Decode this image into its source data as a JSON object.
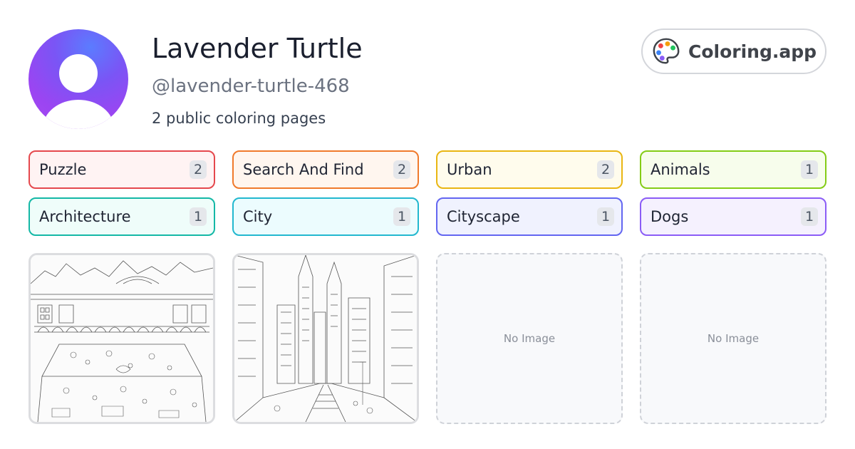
{
  "profile": {
    "name": "Lavender Turtle",
    "handle": "@lavender-turtle-468",
    "page_count_text": "2 public coloring pages",
    "avatar_icon": "user-avatar-icon",
    "avatar_gradient": [
      "#5b7cff",
      "#a848ef"
    ]
  },
  "brand": {
    "label": "Coloring.app",
    "icon": "palette-icon"
  },
  "tags": [
    {
      "label": "Puzzle",
      "count": "2",
      "border": "#e5484d",
      "bg": "#fff3f3"
    },
    {
      "label": "Search And Find",
      "count": "2",
      "border": "#f07a2c",
      "bg": "#fff6ef"
    },
    {
      "label": "Urban",
      "count": "2",
      "border": "#e9b613",
      "bg": "#fffced"
    },
    {
      "label": "Animals",
      "count": "1",
      "border": "#84cc16",
      "bg": "#f7fdec"
    },
    {
      "label": "Architecture",
      "count": "1",
      "border": "#14b8a6",
      "bg": "#effdfa"
    },
    {
      "label": "City",
      "count": "1",
      "border": "#22b8cf",
      "bg": "#ecfcfe"
    },
    {
      "label": "Cityscape",
      "count": "1",
      "border": "#6366f1",
      "bg": "#f0f2fe"
    },
    {
      "label": "Dogs",
      "count": "1",
      "border": "#8b5cf6",
      "bg": "#f5f1fe"
    }
  ],
  "cards": [
    {
      "type": "image",
      "subject": "market-square-puzzle-drawing"
    },
    {
      "type": "image",
      "subject": "city-street-skyscrapers-drawing"
    },
    {
      "type": "empty",
      "text": "No Image"
    },
    {
      "type": "empty",
      "text": "No Image"
    }
  ]
}
